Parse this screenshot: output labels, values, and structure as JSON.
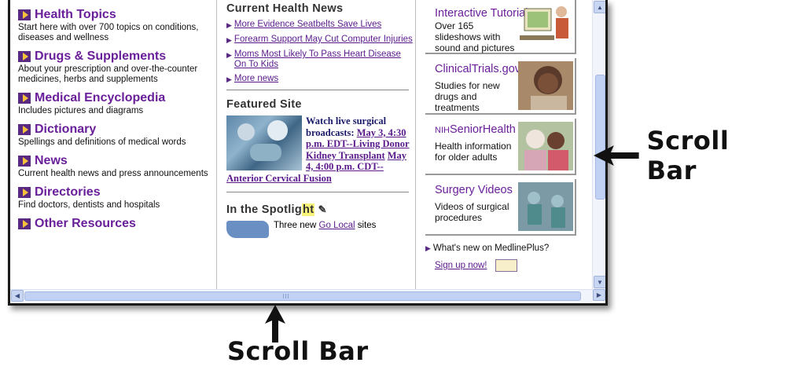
{
  "left": {
    "topics": [
      {
        "title": "Health Topics",
        "desc": "Start here with over 700 topics on conditions, diseases and wellness"
      },
      {
        "title": "Drugs & Supplements",
        "desc": "About your prescription and over-the-counter medicines, herbs and supplements"
      },
      {
        "title": "Medical Encyclopedia",
        "desc": "Includes pictures and diagrams"
      },
      {
        "title": "Dictionary",
        "desc": "Spellings and definitions of medical words"
      },
      {
        "title": "News",
        "desc": "Current health news and press announcements"
      },
      {
        "title": "Directories",
        "desc": "Find doctors, dentists and hospitals"
      },
      {
        "title": "Other Resources",
        "desc": ""
      }
    ]
  },
  "middle": {
    "news_heading": "Current Health News",
    "news": [
      "More Evidence Seatbelts Save Lives",
      "Forearm Support May Cut Computer Injuries",
      "Moms Most Likely To Pass Heart Disease On To Kids",
      "More news"
    ],
    "featured_heading": "Featured Site",
    "featured_plain": "Watch live surgical broadcasts:",
    "featured_link1": "May 3, 4:30 p.m. EDT--Living Donor Kidney Transplant",
    "featured_link2": "May 4, 4:00 p.m. CDT--Anterior Cervical Fusion",
    "spotlight_heading_a": "In the Spotlig",
    "spotlight_heading_b": "ht",
    "spotlight_text_a": "Three new",
    "spotlight_link": "Go Local",
    "spotlight_text_b": "sites"
  },
  "right": {
    "cards": [
      {
        "title": "Interactive Tutorials",
        "desc": "Over 165 slideshows with sound and pictures"
      },
      {
        "title": "ClinicalTrials.gov",
        "desc": "Studies for new drugs and treatments"
      },
      {
        "title_prefix": "NIH",
        "title": "SeniorHealth",
        "desc": "Health information for older adults"
      },
      {
        "title": "Surgery Videos",
        "desc": "Videos of surgical procedures"
      }
    ],
    "whats_new": "What's new on MedlinePlus?",
    "signup": "Sign up now!"
  },
  "annotations": {
    "right_label": "Scroll Bar",
    "bottom_label": "Scroll Bar"
  },
  "colors": {
    "accent_purple": "#6a1f9a",
    "link_purple": "#5a1a8c",
    "scroll_blue": "#c1d1f4"
  }
}
